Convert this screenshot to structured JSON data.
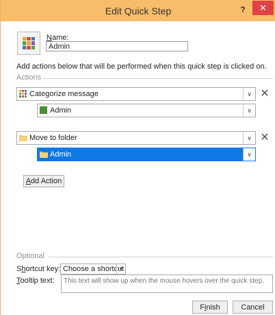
{
  "window": {
    "title": "Edit Quick Step",
    "help_label": "?",
    "close_label": "✕"
  },
  "name_field": {
    "label_prefix": "N",
    "label_rest": "ame:",
    "value": "Admin"
  },
  "instruction": "Add actions below that will be performed when this quick step is clicked on.",
  "actions_section": {
    "label": "Actions",
    "items": [
      {
        "action": "Categorize message",
        "icon": "categorize-icon",
        "option": "Admin",
        "option_icon": "category-color-icon",
        "option_color": "#4f8a3a",
        "remove_label": "✕"
      },
      {
        "action": "Move to folder",
        "icon": "folder-icon",
        "option": "Admin",
        "option_icon": "folder-icon",
        "option_selected": true,
        "remove_label": "✕"
      }
    ],
    "add_action_prefix": "A",
    "add_action_rest": "dd Action"
  },
  "optional_section": {
    "label": "Optional",
    "shortcut_label_pre": "S",
    "shortcut_label_u": "h",
    "shortcut_label_post": "ortcut key:",
    "shortcut_value": "Choose a shortcut",
    "tooltip_label_u": "T",
    "tooltip_label_rest": "ooltip text:",
    "tooltip_placeholder": "This text will show up when the mouse hovers over the quick step."
  },
  "footer": {
    "finish_pre": "F",
    "finish_u": "i",
    "finish_post": "nish",
    "cancel_label": "Cancel"
  },
  "colors": {
    "titlebar": "#f9bd69",
    "close": "#e04343",
    "selection": "#0f7ae5"
  }
}
